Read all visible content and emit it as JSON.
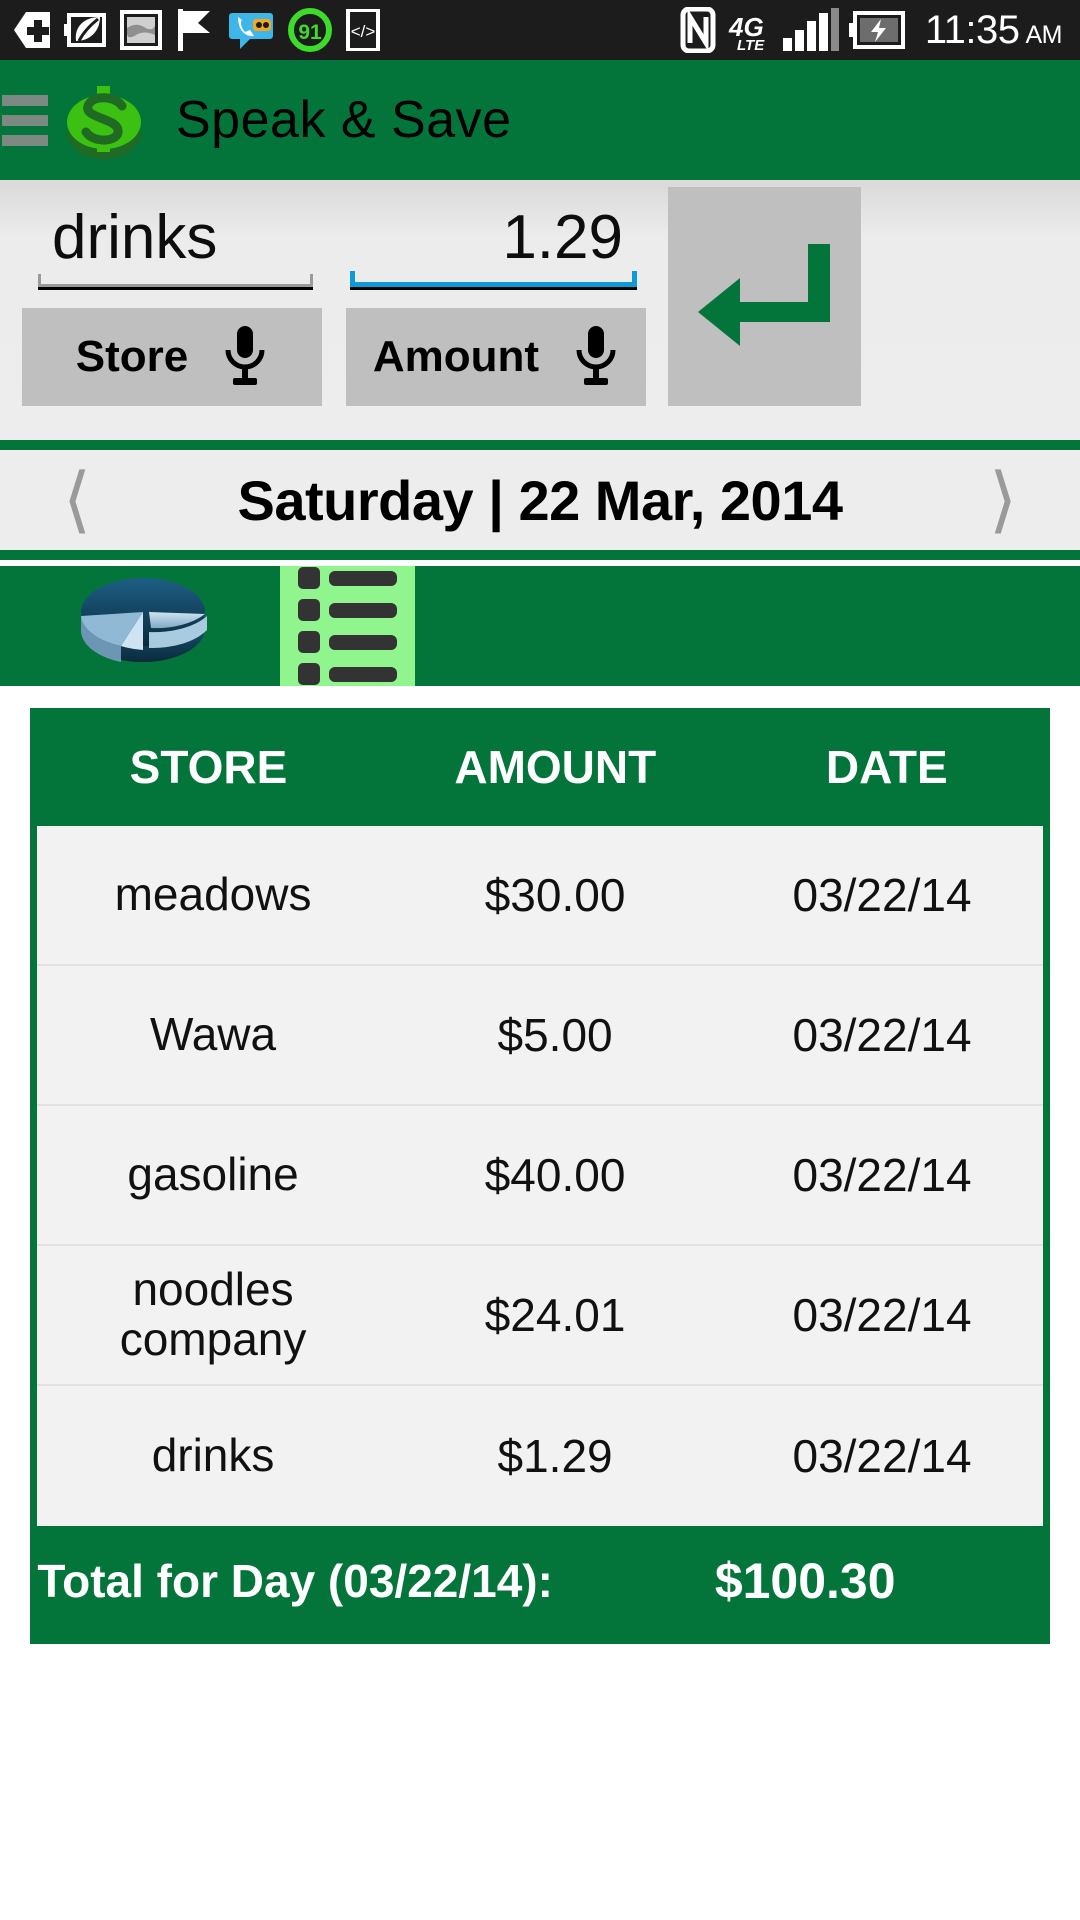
{
  "status_bar": {
    "time": "11:35",
    "meridiem": "AM",
    "battery_text": "91",
    "network": "4G",
    "network_sub": "LTE",
    "icons": [
      "medical-cross-icon",
      "leaf-battery-icon",
      "photo-icon",
      "flag-icon",
      "voicemail-icon",
      "battery-percent-icon",
      "code-brackets-icon",
      "nfc-icon",
      "signal-bars-icon",
      "battery-charging-icon"
    ]
  },
  "app_bar": {
    "title": "Speak & Save",
    "menu_icon": "hamburger-menu-icon",
    "logo_icon": "dollar-sign-logo",
    "background": "#04753a",
    "logo_color": "#3cc113"
  },
  "entry_form": {
    "store_value": "drinks",
    "store_placeholder": "Store",
    "amount_value": "1.29",
    "amount_placeholder": "Amount",
    "store_button_label": "Store",
    "amount_button_label": "Amount",
    "mic_icon": "microphone-icon",
    "submit_icon": "enter-return-arrow-icon",
    "amount_focus_color": "#0d9bd8",
    "store_underline_color": "#9a9a9a"
  },
  "date_nav": {
    "prev_icon": "chevron-left-icon",
    "next_icon": "chevron-right-icon",
    "label": "Saturday | 22 Mar, 2014"
  },
  "tabs": [
    {
      "id": "tab-pie-chart",
      "icon": "pie-chart-icon",
      "selected": false
    },
    {
      "id": "tab-list",
      "icon": "list-icon",
      "selected": true
    }
  ],
  "table": {
    "columns": [
      "STORE",
      "AMOUNT",
      "DATE"
    ],
    "rows": [
      {
        "store": "meadows",
        "amount": "$30.00",
        "date": "03/22/14"
      },
      {
        "store": "Wawa",
        "amount": "$5.00",
        "date": "03/22/14"
      },
      {
        "store": "gasoline",
        "amount": "$40.00",
        "date": "03/22/14"
      },
      {
        "store": "noodles company",
        "amount": "$24.01",
        "date": "03/22/14"
      },
      {
        "store": "drinks",
        "amount": "$1.29",
        "date": "03/22/14"
      }
    ],
    "footer_label": "Total for Day (03/22/14):",
    "footer_value": "$100.30"
  }
}
